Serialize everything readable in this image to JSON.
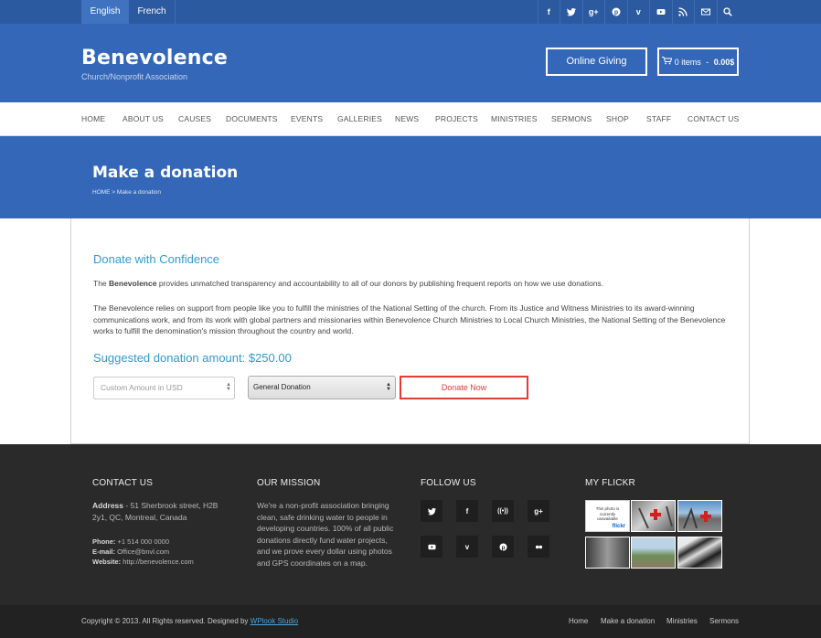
{
  "topbar": {
    "languages": [
      "English",
      "French"
    ],
    "social_icons": [
      "facebook-icon",
      "twitter-icon",
      "google-plus-icon",
      "pinterest-icon",
      "vimeo-icon",
      "youtube-icon",
      "rss-icon",
      "mail-icon",
      "search-icon"
    ]
  },
  "header": {
    "title": "Benevolence",
    "subtitle": "Church/Nonprofit Association",
    "giving_label": "Online Giving",
    "cart_items": "0 items",
    "cart_sep": " - ",
    "cart_total": "0.00$"
  },
  "nav": {
    "items": [
      "HOME",
      "ABOUT US",
      "CAUSES",
      "DOCUMENTS",
      "EVENTS",
      "GALLERIES",
      "NEWS",
      "PROJECTS",
      "MINISTRIES",
      "SERMONS",
      "SHOP",
      "STAFF",
      "CONTACT US"
    ]
  },
  "banner": {
    "title": "Make a donation",
    "breadcrumb_home": "HOME",
    "breadcrumb_sep": " > ",
    "breadcrumb_current": "Make a donation"
  },
  "content": {
    "heading": "Donate with Confidence",
    "p1_pre": "The ",
    "p1_bold": "Benevolence",
    "p1_post": " provides unmatched transparency and accountability to all of our donors by publishing frequent reports on how we use donations.",
    "p2": "The Benevolence relies on support from people like you to fulfill the ministries of the National Setting of the church. From its Justice and Witness Ministries to its award-winning communications work, and from its work with global partners and missionaries within Benevolence Church Ministries to Local Church Ministries, the National Setting of the Benevolence works to fulfill the denomination's mission throughout the country and world.",
    "suggested": "Suggested donation amount: $250.00",
    "amount_placeholder": "Custom Amount in USD",
    "select_value": "General Donation",
    "donate_label": "Donate Now"
  },
  "footer": {
    "contact": {
      "heading": "CONTACT US",
      "address_label": "Address",
      "address": " - 51 Sherbrook street, H2B 2y1, QC, Montreal, Canada",
      "phone_label": "Phone:",
      "phone": " +1 514 000 0000",
      "email_label": "E-mail:",
      "email": " Office@bnvl.com",
      "website_label": "Website:",
      "website": " http://benevolence.com"
    },
    "mission": {
      "heading": "OUR MISSION",
      "text": "We're a non-profit association bringing clean, safe drinking water to people in developing countries. 100% of all public donations directly fund water projects, and we prove every dollar using photos and GPS coordinates on a map."
    },
    "follow": {
      "heading": "FOLLOW US",
      "icons": [
        "twitter-icon",
        "facebook-icon",
        "podcast-icon",
        "google-plus-icon",
        "youtube-icon",
        "vimeo-icon",
        "pinterest-icon",
        "flickr-icon"
      ]
    },
    "flickr": {
      "heading": "MY FLICKR",
      "unavailable_text": "This photo is currently unavailable",
      "unavailable_brand": "flickr"
    }
  },
  "bottom": {
    "copyright": "Copyright © 2013. All Rights reserved. Designed by ",
    "designer": "WPlook Studio",
    "links": [
      "Home",
      "Make a donation",
      "Ministries",
      "Sermons"
    ]
  },
  "colors": {
    "primary_blue": "#3467b8",
    "topbar_blue": "#2b5aa1",
    "heading_cyan": "#2f9ad0",
    "donate_red": "#e53935",
    "footer_dark": "#2a2a2a"
  }
}
